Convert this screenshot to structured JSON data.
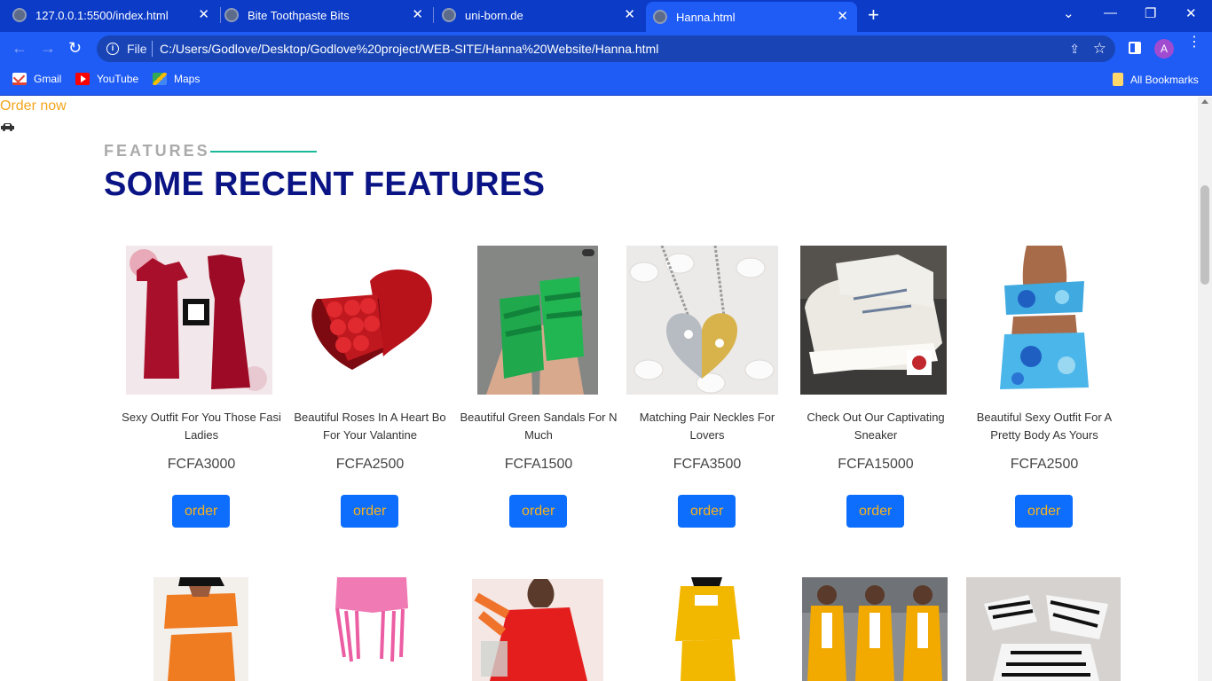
{
  "browser": {
    "tabs": [
      {
        "title": "127.0.0.1:5500/index.html"
      },
      {
        "title": "Bite Toothpaste Bits"
      },
      {
        "title": "uni-born.de"
      },
      {
        "title": "Hanna.html"
      }
    ],
    "file_label": "File",
    "url": "C:/Users/Godlove/Desktop/Godlove%20project/WEB-SITE/Hanna%20Website/Hanna.html",
    "profile_initial": "A",
    "bookmarks": [
      {
        "label": "Gmail",
        "icon": "gmail-icon"
      },
      {
        "label": "YouTube",
        "icon": "youtube-icon"
      },
      {
        "label": "Maps",
        "icon": "maps-icon"
      }
    ],
    "all_bookmarks": "All Bookmarks"
  },
  "page": {
    "order_now": "Order now",
    "section_tag": "FEATURES",
    "section_title": "SOME RECENT FEATURES",
    "products": [
      {
        "name_line1": "Sexy Outfit For You Those Fasi",
        "name_line2": "Ladies",
        "price": "FCFA3000",
        "button": "order",
        "image": "red-dress-image"
      },
      {
        "name_line1": "Beautiful Roses In A Heart Bo",
        "name_line2": "For Your Valantine",
        "price": "FCFA2500",
        "button": "order",
        "image": "rose-heart-box-image"
      },
      {
        "name_line1": "Beautiful Green Sandals For N",
        "name_line2": "Much",
        "price": "FCFA1500",
        "button": "order",
        "image": "green-sandals-image"
      },
      {
        "name_line1": "Matching Pair Neckles For",
        "name_line2": "Lovers",
        "price": "FCFA3500",
        "button": "order",
        "image": "heart-necklace-image"
      },
      {
        "name_line1": "Check Out Our Captivating",
        "name_line2": "Sneaker",
        "price": "FCFA15000",
        "button": "order",
        "image": "white-sneaker-image"
      },
      {
        "name_line1": "Beautiful Sexy Outfit For A",
        "name_line2": "Pretty Body As Yours",
        "price": "FCFA2500",
        "button": "order",
        "image": "tie-dye-outfit-image"
      }
    ]
  },
  "colors": {
    "browser_accent": "#1f5cf5",
    "tab_strip": "#0b3bc7",
    "title": "#0a1484",
    "button": "#0d6efd",
    "button_text": "#f6b21b",
    "tag_line": "#19b99a"
  }
}
